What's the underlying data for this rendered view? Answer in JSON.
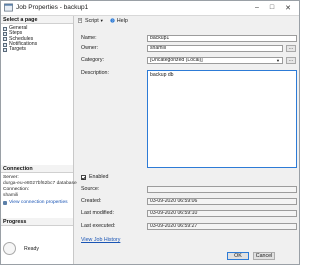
{
  "window": {
    "title": "Job Properties - backup1",
    "minimize_icon": "minimize-icon",
    "maximize_icon": "maximize-icon",
    "close_icon": "close-icon"
  },
  "left_pane": {
    "select_page_header": "Select a page",
    "pages": [
      {
        "label": "General",
        "icon": "page-icon"
      },
      {
        "label": "Steps",
        "icon": "page-icon"
      },
      {
        "label": "Schedules",
        "icon": "page-icon"
      },
      {
        "label": "Notifications",
        "icon": "page-icon"
      },
      {
        "label": "Targets",
        "icon": "page-icon"
      }
    ],
    "connection_header": "Connection",
    "server_label": "Server:",
    "server_value": "durga-eu-e8027bf62bc7 database",
    "connection_label": "Connection:",
    "connection_value": "shamili",
    "view_connection_properties": "View connection properties",
    "progress_header": "Progress",
    "progress_status": "Ready"
  },
  "toolbar": {
    "script_label": "Script",
    "help_label": "Help"
  },
  "form": {
    "name_label": "Name:",
    "name_value": "backup1",
    "owner_label": "Owner:",
    "owner_value": "shamili",
    "owner_browse": "...",
    "category_label": "Category:",
    "category_value": "[Uncategorized (Local)]",
    "category_browse": "...",
    "description_label": "Description:",
    "description_value": "backup db",
    "enabled_label": "Enabled",
    "enabled_checked": true,
    "source_label": "Source:",
    "source_value": "",
    "created_label": "Created:",
    "created_value": "03-09-2020 06:59:06",
    "last_modified_label": "Last modified:",
    "last_modified_value": "03-09-2020 06:59:10",
    "last_executed_label": "Last executed:",
    "last_executed_value": "03-09-2020 06:59:27",
    "view_job_history": "View Job History"
  },
  "buttons": {
    "ok": "OK",
    "cancel": "Cancel"
  },
  "colors": {
    "accent": "#2d7bd6",
    "link": "#1a55b5"
  }
}
